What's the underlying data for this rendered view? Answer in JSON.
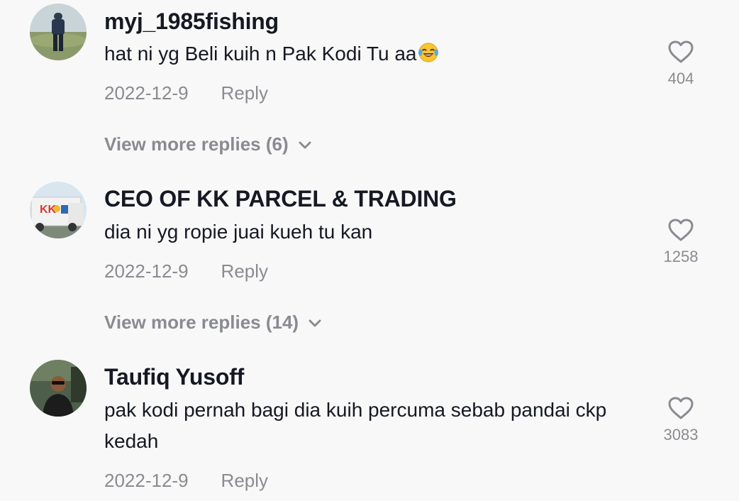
{
  "comments": [
    {
      "username": "myj_1985fishing",
      "text": "hat ni yg Beli kuih n Pak Kodi Tu aa",
      "emoji": "face-with-tears-of-joy",
      "date": "2022-12-9",
      "reply_label": "Reply",
      "likes": "404",
      "more_replies": "View more replies (6)"
    },
    {
      "username": "CEO OF KK PARCEL & TRADING",
      "text": "dia ni yg ropie juai kueh tu kan",
      "date": "2022-12-9",
      "reply_label": "Reply",
      "likes": "1258",
      "more_replies": "View more replies (14)"
    },
    {
      "username": "Taufiq Yusoff",
      "text": "pak kodi pernah bagi dia kuih percuma sebab pandai ckp kedah",
      "date": "2022-12-9",
      "reply_label": "Reply",
      "likes": "3083"
    }
  ],
  "icons": {
    "like": "heart-outline-icon",
    "expand": "chevron-down-icon"
  },
  "colors": {
    "background": "#f8f8f8",
    "primary_text": "#161823",
    "secondary_text": "#8a8b91"
  }
}
